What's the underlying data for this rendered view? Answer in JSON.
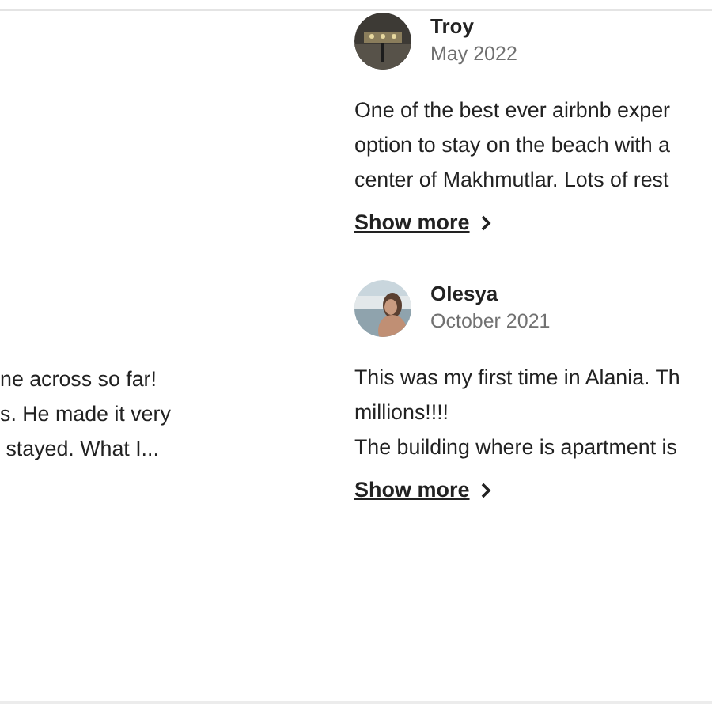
{
  "reviews": [
    {
      "name": "Troy",
      "date": "May 2022",
      "lines": [
        "One of the best ever airbnb exper",
        "option to stay on the beach with a",
        "center of Makhmutlar. Lots of rest"
      ],
      "link": "Show more"
    },
    {
      "lines": [
        "ne across so far!",
        "s. He made it very",
        " stayed. What I..."
      ]
    },
    {
      "name": "Olesya",
      "date": "October 2021",
      "lines": [
        "This was my first time in Alania. Th",
        "millions!!!!",
        "The building where is apartment is"
      ],
      "link": "Show more"
    }
  ]
}
